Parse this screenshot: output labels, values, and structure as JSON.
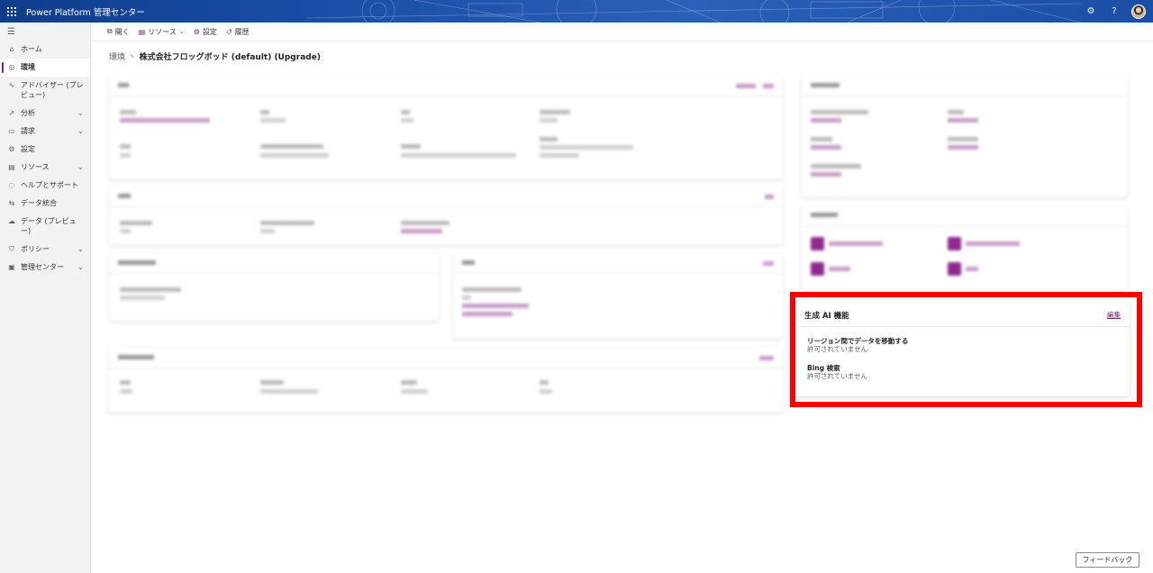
{
  "header": {
    "app_title": "Power Platform 管理センター"
  },
  "nav": {
    "items": [
      {
        "label": "ホーム",
        "icon": "home-icon",
        "chevron": false
      },
      {
        "label": "環境",
        "icon": "environment-icon",
        "chevron": false,
        "active": true
      },
      {
        "label": "アドバイザー (プレビュー)",
        "icon": "advisor-icon",
        "chevron": false
      },
      {
        "label": "分析",
        "icon": "analytics-icon",
        "chevron": true
      },
      {
        "label": "請求",
        "icon": "billing-icon",
        "chevron": true
      },
      {
        "label": "設定",
        "icon": "settings-icon",
        "chevron": false
      },
      {
        "label": "リソース",
        "icon": "resources-icon",
        "chevron": true
      },
      {
        "label": "ヘルプとサポート",
        "icon": "help-support-icon",
        "chevron": false
      },
      {
        "label": "データ統合",
        "icon": "data-integration-icon",
        "chevron": false
      },
      {
        "label": "データ (プレビュー)",
        "icon": "data-preview-icon",
        "chevron": false
      },
      {
        "label": "ポリシー",
        "icon": "policy-icon",
        "chevron": true
      },
      {
        "label": "管理センター",
        "icon": "admin-centers-icon",
        "chevron": true
      }
    ]
  },
  "commands": {
    "open": "開く",
    "resources": "リソース",
    "settings": "設定",
    "history": "履歴"
  },
  "breadcrumb": {
    "parent": "環境",
    "current": "株式会社フロッグボッド (default) (Upgrade)"
  },
  "genai": {
    "title": "生成 AI 機能",
    "edit": "編集",
    "rows": [
      {
        "title": "リージョン間でデータを移動する",
        "value": "許可されていません"
      },
      {
        "title": "Bing 検索",
        "value": "許可されていません"
      }
    ]
  },
  "feedback": "フィードバック",
  "colors": {
    "accent": "#742774",
    "header_bg": "#1b4ea6",
    "highlight": "#ff0000"
  }
}
